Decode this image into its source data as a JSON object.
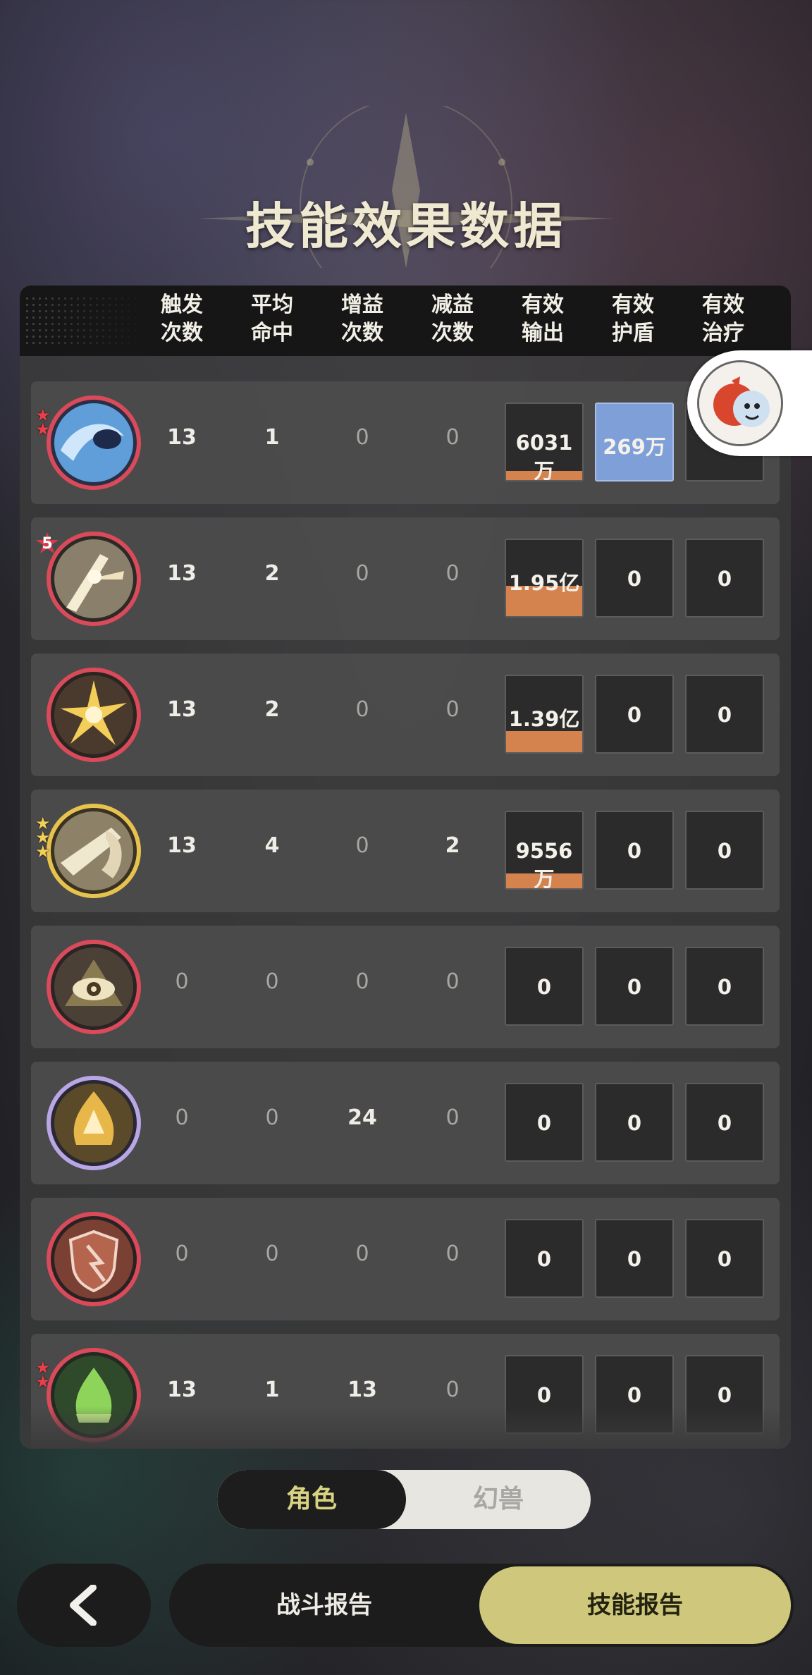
{
  "page": {
    "title": "技能效果数据"
  },
  "table": {
    "headers": [
      {
        "line1": "触发",
        "line2": "次数"
      },
      {
        "line1": "平均",
        "line2": "命中"
      },
      {
        "line1": "增益",
        "line2": "次数"
      },
      {
        "line1": "减益",
        "line2": "次数"
      },
      {
        "line1": "有效",
        "line2": "输出"
      },
      {
        "line1": "有效",
        "line2": "护盾"
      },
      {
        "line1": "有效",
        "line2": "治疗"
      }
    ],
    "rows": [
      {
        "icon": "water-wave-skill-icon",
        "triggers": "13",
        "avg_hits": "1",
        "buffs": "0",
        "debuffs": "0",
        "output": "6031万",
        "output_fill": 0.12,
        "shield": "269万",
        "heal": ""
      },
      {
        "icon": "light-slash-skill-icon",
        "badge": "5",
        "triggers": "13",
        "avg_hits": "2",
        "buffs": "0",
        "debuffs": "0",
        "output": "1.95亿",
        "output_fill": 0.4,
        "shield": "0",
        "heal": "0"
      },
      {
        "icon": "lightning-burst-skill-icon",
        "triggers": "13",
        "avg_hits": "2",
        "buffs": "0",
        "debuffs": "0",
        "output": "1.39亿",
        "output_fill": 0.28,
        "shield": "0",
        "heal": "0"
      },
      {
        "icon": "lance-strike-skill-icon",
        "triggers": "13",
        "avg_hits": "4",
        "buffs": "0",
        "debuffs": "2",
        "output": "9556万",
        "output_fill": 0.19,
        "shield": "0",
        "heal": "0"
      },
      {
        "icon": "eye-skill-icon",
        "triggers": "0",
        "avg_hits": "0",
        "buffs": "0",
        "debuffs": "0",
        "output": "0",
        "output_fill": 0,
        "shield": "0",
        "heal": "0"
      },
      {
        "icon": "golden-flame-skill-icon",
        "triggers": "0",
        "avg_hits": "0",
        "buffs": "24",
        "debuffs": "0",
        "output": "0",
        "output_fill": 0,
        "shield": "0",
        "heal": "0"
      },
      {
        "icon": "broken-shield-skill-icon",
        "triggers": "0",
        "avg_hits": "0",
        "buffs": "0",
        "debuffs": "0",
        "output": "0",
        "output_fill": 0,
        "shield": "0",
        "heal": "0"
      },
      {
        "icon": "green-flame-skill-icon",
        "triggers": "13",
        "avg_hits": "1",
        "buffs": "13",
        "debuffs": "0",
        "output": "0",
        "output_fill": 0,
        "shield": "0",
        "heal": "0"
      }
    ]
  },
  "toggle": {
    "active_label": "角色",
    "inactive_label": "幻兽"
  },
  "nav": {
    "back_icon": "chevron-left-icon",
    "battle_report": "战斗报告",
    "skill_report": "技能报告"
  },
  "colors": {
    "accent_yellow": "#cfc87c",
    "output_bar": "#d4834f",
    "shield_blue": "#7f9fd8"
  }
}
